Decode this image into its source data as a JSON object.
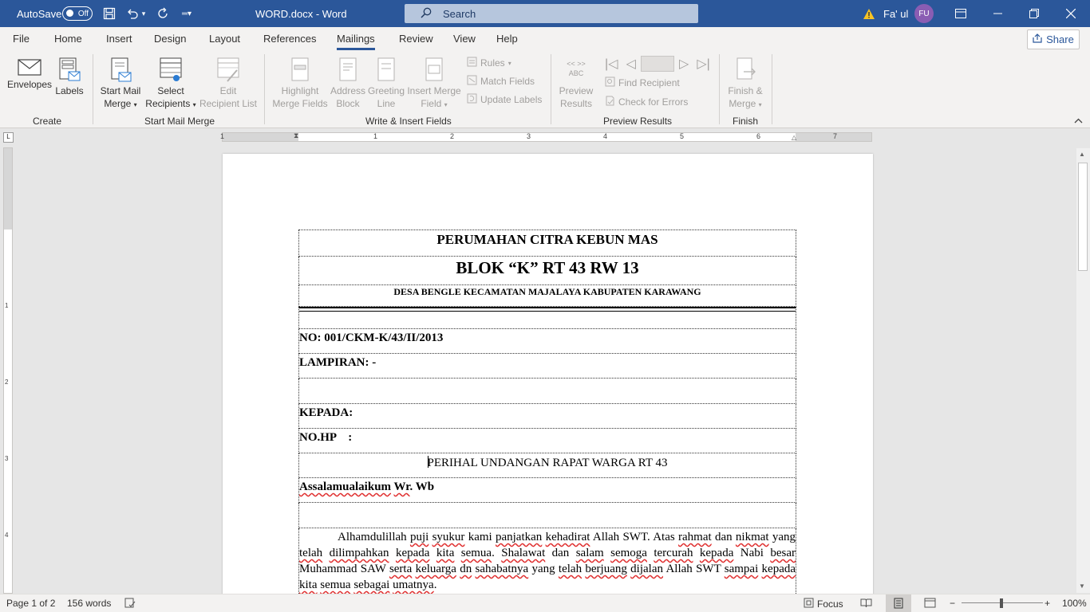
{
  "titlebar": {
    "autosave_label": "AutoSave",
    "autosave_state": "Off",
    "doc_title": "WORD.docx  -  Word",
    "search_placeholder": "Search",
    "warning_icon": "warning-icon",
    "user_name": "Fa' ul",
    "user_initials": "FU"
  },
  "menu": {
    "tabs": [
      "File",
      "Home",
      "Insert",
      "Design",
      "Layout",
      "References",
      "Mailings",
      "Review",
      "View",
      "Help"
    ],
    "active": "Mailings",
    "share_label": "Share"
  },
  "ribbon": {
    "create": {
      "envelopes": "Envelopes",
      "labels": "Labels",
      "group": "Create"
    },
    "start": {
      "start_mail_merge_1": "Start Mail",
      "start_mail_merge_2": "Merge",
      "select_recipients_1": "Select",
      "select_recipients_2": "Recipients",
      "edit_list_1": "Edit",
      "edit_list_2": "Recipient List",
      "group": "Start Mail Merge"
    },
    "write": {
      "highlight_1": "Highlight",
      "highlight_2": "Merge Fields",
      "address_1": "Address",
      "address_2": "Block",
      "greeting_1": "Greeting",
      "greeting_2": "Line",
      "insert_1": "Insert Merge",
      "insert_2": "Field",
      "rules": "Rules",
      "match": "Match Fields",
      "update": "Update Labels",
      "group": "Write & Insert Fields"
    },
    "preview": {
      "preview_1": "Preview",
      "preview_2": "Results",
      "abc": "ABC",
      "find": "Find Recipient",
      "check": "Check for Errors",
      "group": "Preview Results"
    },
    "finish": {
      "finish_1": "Finish &",
      "finish_2": "Merge",
      "group": "Finish"
    }
  },
  "ruler": {
    "numbers": [
      "1",
      "1",
      "2",
      "3",
      "4",
      "5",
      "6",
      "7"
    ],
    "vnumbers": [
      "1",
      "2",
      "3",
      "4"
    ]
  },
  "document": {
    "line1": "PERUMAHAN CITRA KEBUN MAS",
    "line2": "BLOK “K” RT 43 RW 13",
    "line3": "DESA BENGLE KECAMATAN MAJALAYA KABUPATEN KARAWANG",
    "no": "NO: 001/CKM-K/43/II/2013",
    "lampiran": "LAMPIRAN: -",
    "kepada": "KEPADA:",
    "nohp": "NO.HP    :",
    "perihal": "PERIHAL UNDANGAN RAPAT WARGA RT 43",
    "salam_a": "Assalamualaikum",
    "salam_b": "Wr",
    "salam_c": ". Wb",
    "body": [
      {
        "t": "Alhamdulillah ",
        "s": false
      },
      {
        "t": "puji",
        "s": true
      },
      {
        "t": " ",
        "s": false
      },
      {
        "t": "syukur",
        "s": true
      },
      {
        "t": " kami ",
        "s": false
      },
      {
        "t": "panjatkan",
        "s": true
      },
      {
        "t": " ",
        "s": false
      },
      {
        "t": "kehadirat",
        "s": true
      },
      {
        "t": " Allah SWT. Atas ",
        "s": false
      },
      {
        "t": "rahmat",
        "s": true
      },
      {
        "t": " dan ",
        "s": false
      },
      {
        "t": "nikmat",
        "s": true
      },
      {
        "t": " yang ",
        "s": false
      },
      {
        "t": "telah",
        "s": true
      },
      {
        "t": " ",
        "s": false
      },
      {
        "t": "dilimpahkan",
        "s": true
      },
      {
        "t": " ",
        "s": false
      },
      {
        "t": "kepada",
        "s": true
      },
      {
        "t": " ",
        "s": false
      },
      {
        "t": "kita",
        "s": true
      },
      {
        "t": " ",
        "s": false
      },
      {
        "t": "semua",
        "s": true
      },
      {
        "t": ". ",
        "s": false
      },
      {
        "t": "Shalawat",
        "s": true
      },
      {
        "t": " dan ",
        "s": false
      },
      {
        "t": "salam",
        "s": true
      },
      {
        "t": " ",
        "s": false
      },
      {
        "t": "semoga",
        "s": true
      },
      {
        "t": " ",
        "s": false
      },
      {
        "t": "tercurah",
        "s": true
      },
      {
        "t": " ",
        "s": false
      },
      {
        "t": "kepada",
        "s": true
      },
      {
        "t": " Nabi ",
        "s": false
      },
      {
        "t": "besar",
        "s": true
      },
      {
        "t": " Muhammad SAW ",
        "s": false
      },
      {
        "t": "serta",
        "s": true
      },
      {
        "t": " ",
        "s": false
      },
      {
        "t": "keluarga",
        "s": true
      },
      {
        "t": " ",
        "s": false
      },
      {
        "t": "dn",
        "s": true
      },
      {
        "t": " ",
        "s": false
      },
      {
        "t": "sahabatnya",
        "s": true
      },
      {
        "t": " yang ",
        "s": false
      },
      {
        "t": "telah",
        "s": true
      },
      {
        "t": " ",
        "s": false
      },
      {
        "t": "berjuang",
        "s": true
      },
      {
        "t": " ",
        "s": false
      },
      {
        "t": "dijalan",
        "s": true
      },
      {
        "t": " Allah SWT ",
        "s": false
      },
      {
        "t": "sampai",
        "s": true
      },
      {
        "t": " ",
        "s": false
      },
      {
        "t": "kepada",
        "s": true
      },
      {
        "t": " ",
        "s": false
      },
      {
        "t": "kita",
        "s": true
      },
      {
        "t": " ",
        "s": false
      },
      {
        "t": "semua",
        "s": true
      },
      {
        "t": " ",
        "s": false
      },
      {
        "t": "sebagai",
        "s": true
      },
      {
        "t": " ",
        "s": false
      },
      {
        "t": "umatnya",
        "s": true
      },
      {
        "t": ".",
        "s": false
      }
    ]
  },
  "status": {
    "page": "Page 1 of 2",
    "words": "156 words",
    "focus": "Focus",
    "zoom": "100%"
  }
}
